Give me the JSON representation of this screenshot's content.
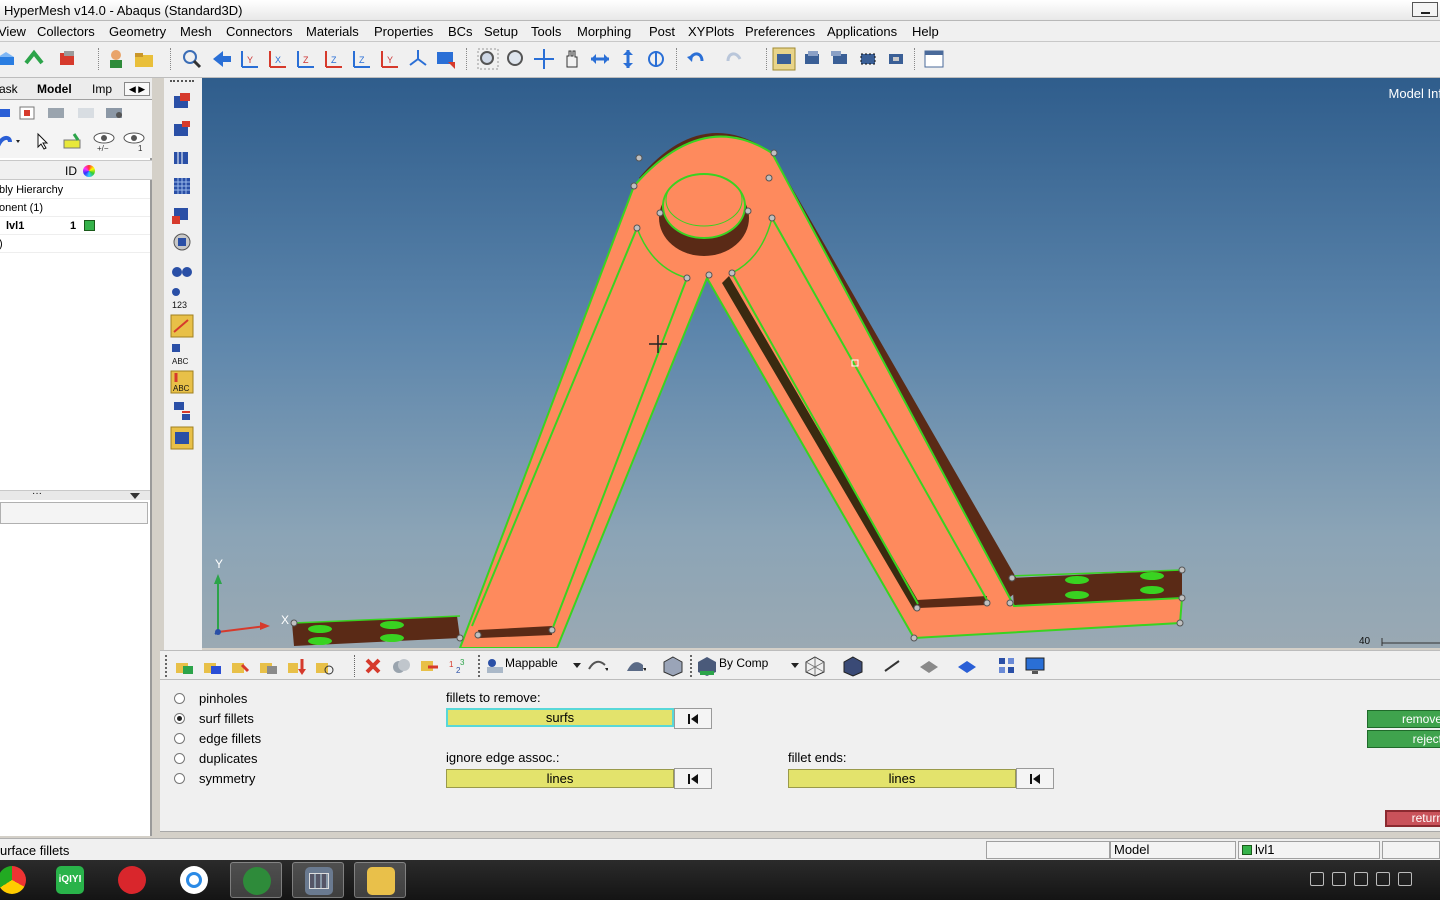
{
  "window": {
    "title": "HyperMesh v14.0 - Abaqus (Standard3D)"
  },
  "menu": [
    "View",
    "Collectors",
    "Geometry",
    "Mesh",
    "Connectors",
    "Materials",
    "Properties",
    "BCs",
    "Setup",
    "Tools",
    "Morphing",
    "Post",
    "XYPlots",
    "Preferences",
    "Applications",
    "Help"
  ],
  "browser": {
    "tabs": [
      "ask",
      "Model",
      "Imp"
    ],
    "id_header": "ID",
    "rows": [
      {
        "label": "bly Hierarchy",
        "id": ""
      },
      {
        "label": "onent (1)",
        "id": ""
      },
      {
        "label": "lvl1",
        "id": "1"
      },
      {
        "label": ")",
        "id": ""
      }
    ]
  },
  "viewport": {
    "model_info": "Model Inf",
    "axis_y": "Y",
    "axis_x": "X",
    "scale_label": "40"
  },
  "bottom_toolbar": {
    "mappable": "Mappable",
    "by_comp": "By Comp"
  },
  "panel": {
    "options": [
      {
        "label": "pinholes",
        "selected": false
      },
      {
        "label": "surf fillets",
        "selected": true
      },
      {
        "label": "edge fillets",
        "selected": false
      },
      {
        "label": "duplicates",
        "selected": false
      },
      {
        "label": "symmetry",
        "selected": false
      }
    ],
    "fillets_to_remove_label": "fillets to remove:",
    "fillets_to_remove_value": "surfs",
    "ignore_edge_label": "ignore edge assoc.:",
    "ignore_edge_value": "lines",
    "fillet_ends_label": "fillet ends:",
    "fillet_ends_value": "lines",
    "remove_btn": "remove",
    "reject_btn": "reject",
    "return_btn": "return"
  },
  "status": {
    "message": "urface fillets",
    "model": "Model",
    "component": "lvl1"
  },
  "colors": {
    "part_face": "#fe8a5d",
    "part_dark": "#5a2a16",
    "edge_green": "#39d321",
    "selection_yellow": "#e3e36c",
    "accept_green": "#3fa34d",
    "return_red": "#c9525a"
  }
}
